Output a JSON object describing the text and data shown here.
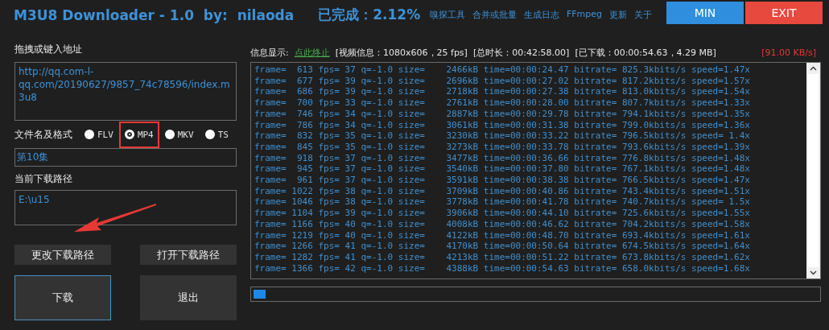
{
  "window": {
    "title": "M3U8 Downloader - 1.0  by:  nilaoda",
    "progress_text": "已完成：2.12%"
  },
  "menu": [
    "嗅探工具",
    "合并或批量",
    "生成日志",
    "FFmpeg",
    "更新",
    "关于"
  ],
  "window_buttons": [
    {
      "label": "MIN",
      "kind": "min"
    },
    {
      "label": "EXIT",
      "kind": "exit"
    }
  ],
  "address": {
    "label": "拖拽或键入地址",
    "value": "http://qq.com-l-qq.com/20190627/9857_74c78596/index.m3u8"
  },
  "format": {
    "label": "文件名及格式",
    "options": [
      {
        "label": "FLV",
        "selected": false,
        "highlighted": false
      },
      {
        "label": "MP4",
        "selected": true,
        "highlighted": true
      },
      {
        "label": "MKV",
        "selected": false,
        "highlighted": false
      },
      {
        "label": "TS",
        "selected": false,
        "highlighted": false
      }
    ],
    "filename": "第10集"
  },
  "path": {
    "label": "当前下载路径",
    "value": "E:\\u15"
  },
  "buttons": [
    {
      "label": "更改下载路径",
      "kind": "small",
      "focused": false
    },
    {
      "label": "打开下载路径",
      "kind": "small",
      "focused": false
    },
    {
      "label": "下载",
      "kind": "large",
      "focused": true
    },
    {
      "label": "退出",
      "kind": "large",
      "focused": false
    }
  ],
  "info": {
    "label": "信息显示:",
    "stop_link": "点此终止",
    "video": "[视频信息：1080x606，25 fps]",
    "duration": "[总时长：00:42:58.00]",
    "downloaded": "[已下载：00:00:54.63，4.29 MB]",
    "speed": "[91.00 KB/s]"
  },
  "log": [
    "frame=  613 fps= 37 q=-1.0 size=    2466kB time=00:00:24.47 bitrate= 825.3kbits/s speed=1.47x",
    "frame=  677 fps= 39 q=-1.0 size=    2696kB time=00:00:27.02 bitrate= 817.2kbits/s speed=1.57x",
    "frame=  686 fps= 39 q=-1.0 size=    2718kB time=00:00:27.38 bitrate= 813.0kbits/s speed=1.54x",
    "frame=  700 fps= 33 q=-1.0 size=    2761kB time=00:00:28.00 bitrate= 807.7kbits/s speed=1.33x",
    "frame=  746 fps= 34 q=-1.0 size=    2887kB time=00:00:29.78 bitrate= 794.1kbits/s speed=1.35x",
    "frame=  786 fps= 34 q=-1.0 size=    3061kB time=00:00:31.38 bitrate= 799.0kbits/s speed=1.36x",
    "frame=  832 fps= 35 q=-1.0 size=    3230kB time=00:00:33.22 bitrate= 796.5kbits/s speed= 1.4x",
    "frame=  845 fps= 35 q=-1.0 size=    3273kB time=00:00:33.78 bitrate= 793.6kbits/s speed=1.39x",
    "frame=  918 fps= 37 q=-1.0 size=    3477kB time=00:00:36.66 bitrate= 776.8kbits/s speed=1.48x",
    "frame=  945 fps= 37 q=-1.0 size=    3540kB time=00:00:37.80 bitrate= 767.1kbits/s speed=1.48x",
    "frame=  961 fps= 37 q=-1.0 size=    3591kB time=00:00:38.38 bitrate= 766.5kbits/s speed=1.47x",
    "frame= 1022 fps= 38 q=-1.0 size=    3709kB time=00:00:40.86 bitrate= 743.4kbits/s speed=1.51x",
    "frame= 1046 fps= 38 q=-1.0 size=    3778kB time=00:00:41.78 bitrate= 740.7kbits/s speed= 1.5x",
    "frame= 1104 fps= 39 q=-1.0 size=    3906kB time=00:00:44.10 bitrate= 725.6kbits/s speed=1.55x",
    "frame= 1166 fps= 40 q=-1.0 size=    4008kB time=00:00:46.62 bitrate= 704.2kbits/s speed=1.58x",
    "frame= 1219 fps= 40 q=-1.0 size=    4122kB time=00:00:48.70 bitrate= 693.4kbits/s speed=1.61x",
    "frame= 1266 fps= 41 q=-1.0 size=    4170kB time=00:00:50.64 bitrate= 674.5kbits/s speed=1.64x",
    "frame= 1282 fps= 41 q=-1.0 size=    4213kB time=00:00:51.22 bitrate= 673.8kbits/s speed=1.62x",
    "frame= 1366 fps= 42 q=-1.0 size=    4388kB time=00:00:54.63 bitrate= 658.0kbits/s speed=1.68x"
  ],
  "progress": {
    "level": 0.0212
  }
}
